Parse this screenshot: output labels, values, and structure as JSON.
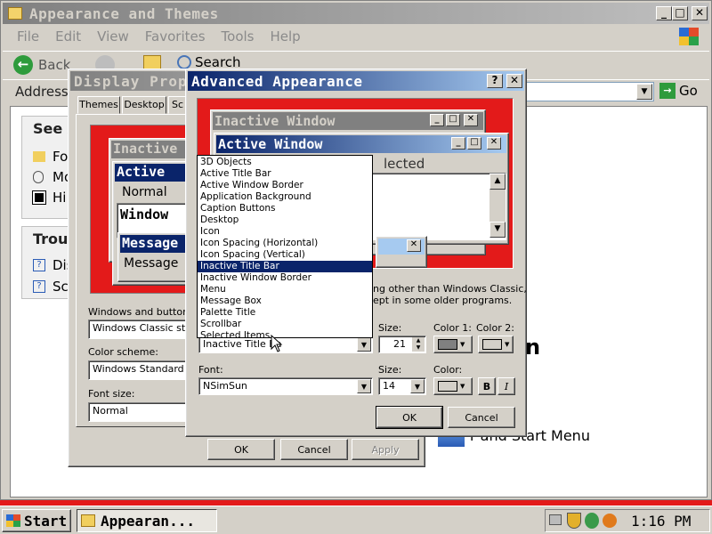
{
  "explorer": {
    "title": "Appearance and Themes",
    "menu": [
      "File",
      "Edit",
      "View",
      "Favorites",
      "Tools",
      "Help"
    ],
    "toolbar": {
      "back": "Back",
      "search": "Search",
      "folders": "Folders"
    },
    "address_label": "Address",
    "go_label": "Go",
    "see_also_header": "See A",
    "see_also_items": [
      "Fo",
      "Mo",
      "Hi"
    ],
    "trouble_header": "Troul",
    "trouble_items": [
      "Dis",
      "Sc"
    ],
    "main_heading_fragment": "n",
    "task_fragment": "r and Start Menu"
  },
  "display_properties": {
    "title": "Display Prop",
    "tabs": [
      "Themes",
      "Desktop",
      "Sc"
    ],
    "preview": {
      "inactive": "Inactive",
      "active": "Active",
      "normal": "Normal",
      "window_text": "Window",
      "message": "Message",
      "message_text": "Message"
    },
    "windows_buttons_label": "Windows and buttons:",
    "windows_buttons_value": "Windows Classic style",
    "color_scheme_label": "Color scheme:",
    "color_scheme_value": "Windows Standard",
    "font_size_label": "Font size:",
    "font_size_value": "Normal",
    "ok": "OK",
    "cancel": "Cancel",
    "apply": "Apply"
  },
  "advanced": {
    "title": "Advanced Appearance",
    "help": "?",
    "close": "✕",
    "preview": {
      "inactive_window": "Inactive Window",
      "active_window": "Active Window",
      "selected_fragment": "lected"
    },
    "note_line1": "ng other than Windows Classic,",
    "note_line2": "ept in some older programs.",
    "item_label": "Item:",
    "item_value": "Inactive Title Ba",
    "size_label": "Size:",
    "size_value": "21",
    "color1_label": "Color 1:",
    "color2_label": "Color 2:",
    "font_label": "Font:",
    "font_value": "NSimSun",
    "font_size_label": "Size:",
    "font_size_value": "14",
    "font_color_label": "Color:",
    "bold": "B",
    "italic": "I",
    "ok": "OK",
    "cancel": "Cancel",
    "dropdown_items": [
      "3D Objects",
      "Active Title Bar",
      "Active Window Border",
      "Application Background",
      "Caption Buttons",
      "Desktop",
      "Icon",
      "Icon Spacing (Horizontal)",
      "Icon Spacing (Vertical)",
      "Inactive Title Bar",
      "Inactive Window Border",
      "Menu",
      "Message Box",
      "Palette Title",
      "Scrollbar",
      "Selected Items"
    ],
    "selected_index": 9
  },
  "taskbar": {
    "start": "Start",
    "task": "Appearan...",
    "clock": "1:16 PM"
  },
  "colors": {
    "active_title_start": "#0a246a",
    "active_title_end": "#a6caf0",
    "inactive_title_start": "#808080",
    "inactive_title_end": "#c0c0c0",
    "preview_bg": "#e31a1a",
    "face": "#d4d0c8"
  }
}
